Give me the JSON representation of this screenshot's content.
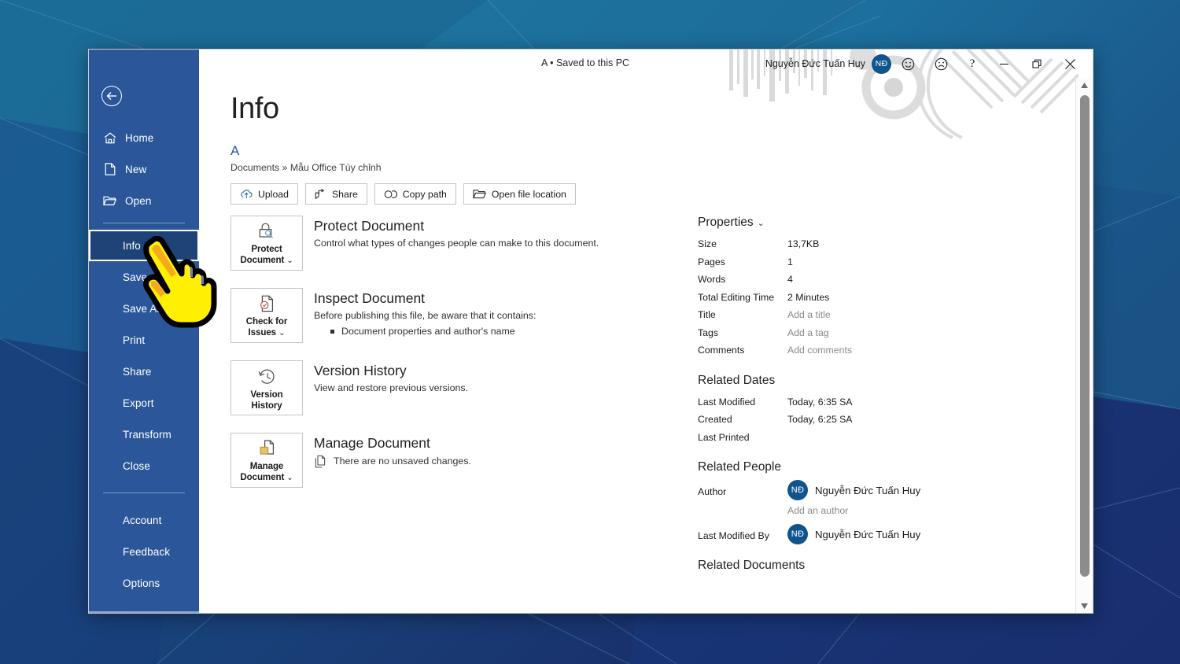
{
  "theme": {
    "office_blue": "#2b579a",
    "selected_blue": "#1e4376",
    "accent_avatar": "#0f548c",
    "doc_name_color": "#2b579a",
    "cursor_yellow": "#ffef00"
  },
  "titlebar": {
    "doc_status": "A • Saved to this PC",
    "account_name": "Nguyễn Đức Tuấn Huy",
    "avatar_initials": "NĐ",
    "buttons": [
      {
        "name": "smiley-face-icon",
        "label": "Send a Smile"
      },
      {
        "name": "frowny-face-icon",
        "label": "Send a Frown"
      },
      {
        "name": "help-icon",
        "label": "?"
      },
      {
        "name": "minimize-icon",
        "label": "Minimize"
      },
      {
        "name": "restore-icon",
        "label": "Restore Down"
      },
      {
        "name": "close-icon",
        "label": "Close"
      }
    ]
  },
  "sidebar": {
    "back_label": "Back",
    "items": [
      {
        "label": "Home",
        "icon": "home-icon",
        "selected": false
      },
      {
        "label": "New",
        "icon": "page-icon",
        "selected": false
      },
      {
        "label": "Open",
        "icon": "folder-icon",
        "selected": false
      },
      {
        "label": "Info",
        "icon": "",
        "selected": true
      },
      {
        "label": "Save",
        "icon": "",
        "selected": false
      },
      {
        "label": "Save As",
        "icon": "",
        "selected": false
      },
      {
        "label": "Print",
        "icon": "",
        "selected": false
      },
      {
        "label": "Share",
        "icon": "",
        "selected": false
      },
      {
        "label": "Export",
        "icon": "",
        "selected": false
      },
      {
        "label": "Transform",
        "icon": "",
        "selected": false
      },
      {
        "label": "Close",
        "icon": "",
        "selected": false
      },
      {
        "label": "Account",
        "icon": "",
        "selected": false
      },
      {
        "label": "Feedback",
        "icon": "",
        "selected": false
      },
      {
        "label": "Options",
        "icon": "",
        "selected": false
      }
    ]
  },
  "main": {
    "page_title": "Info",
    "document_name": "A",
    "breadcrumb": "Documents » Mẫu Office Tùy chỉnh",
    "action_buttons": [
      {
        "label": "Upload",
        "icon": "cloud-upload-icon"
      },
      {
        "label": "Share",
        "icon": "share-arrow-icon"
      },
      {
        "label": "Copy path",
        "icon": "link-chain-icon"
      },
      {
        "label": "Open file location",
        "icon": "folder-open-icon"
      }
    ],
    "features": [
      {
        "tile_label_line1": "Protect",
        "tile_label_line2": "Document",
        "tile_has_caret": true,
        "tile_icon": "lock-key-icon",
        "heading": "Protect Document",
        "description": "Control what types of changes people can make to this document.",
        "bullets": [],
        "note": ""
      },
      {
        "tile_label_line1": "Check for",
        "tile_label_line2": "Issues",
        "tile_has_caret": true,
        "tile_icon": "document-check-icon",
        "heading": "Inspect Document",
        "description": "Before publishing this file, be aware that it contains:",
        "bullets": [
          "Document properties and author's name"
        ],
        "note": ""
      },
      {
        "tile_label_line1": "Version",
        "tile_label_line2": "History",
        "tile_has_caret": false,
        "tile_icon": "clock-history-icon",
        "heading": "Version History",
        "description": "View and restore previous versions.",
        "bullets": [],
        "note": ""
      },
      {
        "tile_label_line1": "Manage",
        "tile_label_line2": "Document",
        "tile_has_caret": true,
        "tile_icon": "document-folder-icon",
        "heading": "Manage Document",
        "description": "",
        "bullets": [],
        "note": "There are no unsaved changes."
      }
    ]
  },
  "properties": {
    "heading": "Properties",
    "rows": [
      {
        "key": "Size",
        "value": "13,7KB",
        "placeholder": false
      },
      {
        "key": "Pages",
        "value": "1",
        "placeholder": false
      },
      {
        "key": "Words",
        "value": "4",
        "placeholder": false
      },
      {
        "key": "Total Editing Time",
        "value": "2 Minutes",
        "placeholder": false
      },
      {
        "key": "Title",
        "value": "Add a title",
        "placeholder": true
      },
      {
        "key": "Tags",
        "value": "Add a tag",
        "placeholder": true
      },
      {
        "key": "Comments",
        "value": "Add comments",
        "placeholder": true
      }
    ]
  },
  "related_dates": {
    "heading": "Related Dates",
    "rows": [
      {
        "key": "Last Modified",
        "value": "Today, 6:35 SA"
      },
      {
        "key": "Created",
        "value": "Today, 6:25 SA"
      },
      {
        "key": "Last Printed",
        "value": ""
      }
    ]
  },
  "related_people": {
    "heading": "Related People",
    "author_key": "Author",
    "author_name": "Nguyễn Đức Tuấn Huy",
    "author_initials": "NĐ",
    "add_author_placeholder": "Add an author",
    "modified_key": "Last Modified By",
    "modified_name": "Nguyễn Đức Tuấn Huy",
    "modified_initials": "NĐ"
  },
  "related_documents": {
    "heading": "Related Documents"
  },
  "overlay": {
    "cursor": "pointing-hand-cursor"
  }
}
